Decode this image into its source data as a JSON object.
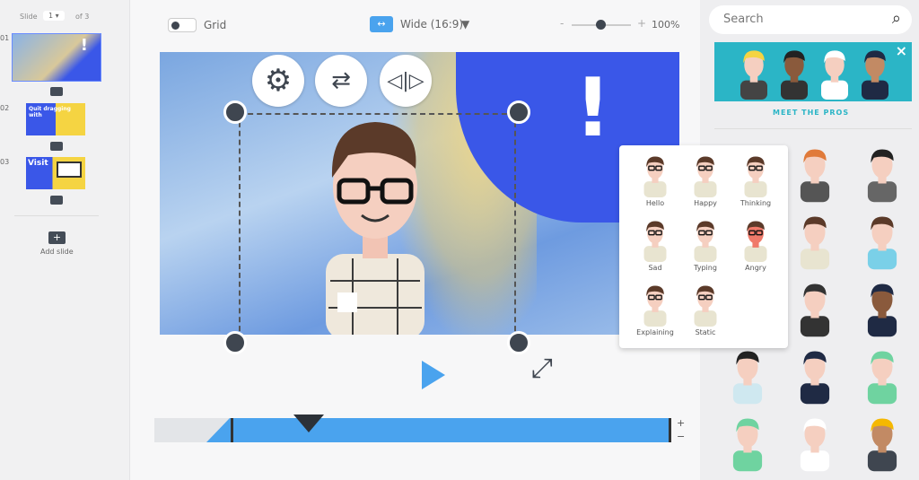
{
  "slides_panel": {
    "slide_label": "Slide",
    "current": "1",
    "of_label": "of 3",
    "numbers": [
      "01",
      "02",
      "03"
    ],
    "slide2_text": "Quit dragging with",
    "slide3_text": "Visit",
    "add_slide": "Add slide"
  },
  "toolbar": {
    "grid_label": "Grid",
    "grid_on": false,
    "aspect": "Wide (16:9)",
    "zoom_minus": "-",
    "zoom_plus": "+",
    "zoom": "100%",
    "zoom_level": 0.55
  },
  "canvas": {
    "exclamation": "!"
  },
  "timeline": {
    "plus": "+",
    "minus": "−",
    "playhead": 0.3
  },
  "poses": [
    "Hello",
    "Happy",
    "Thinking",
    "Sad",
    "Typing",
    "Angry",
    "Explaining",
    "Static"
  ],
  "right": {
    "search_placeholder": "Search",
    "banner_label": "MEET THE PROS",
    "close": "×"
  },
  "colors": {
    "accent": "#4aa3ee",
    "blue": "#3a57e8",
    "yellow": "#f5d442",
    "dark": "#3f4650",
    "teal": "#2bb5c6"
  }
}
